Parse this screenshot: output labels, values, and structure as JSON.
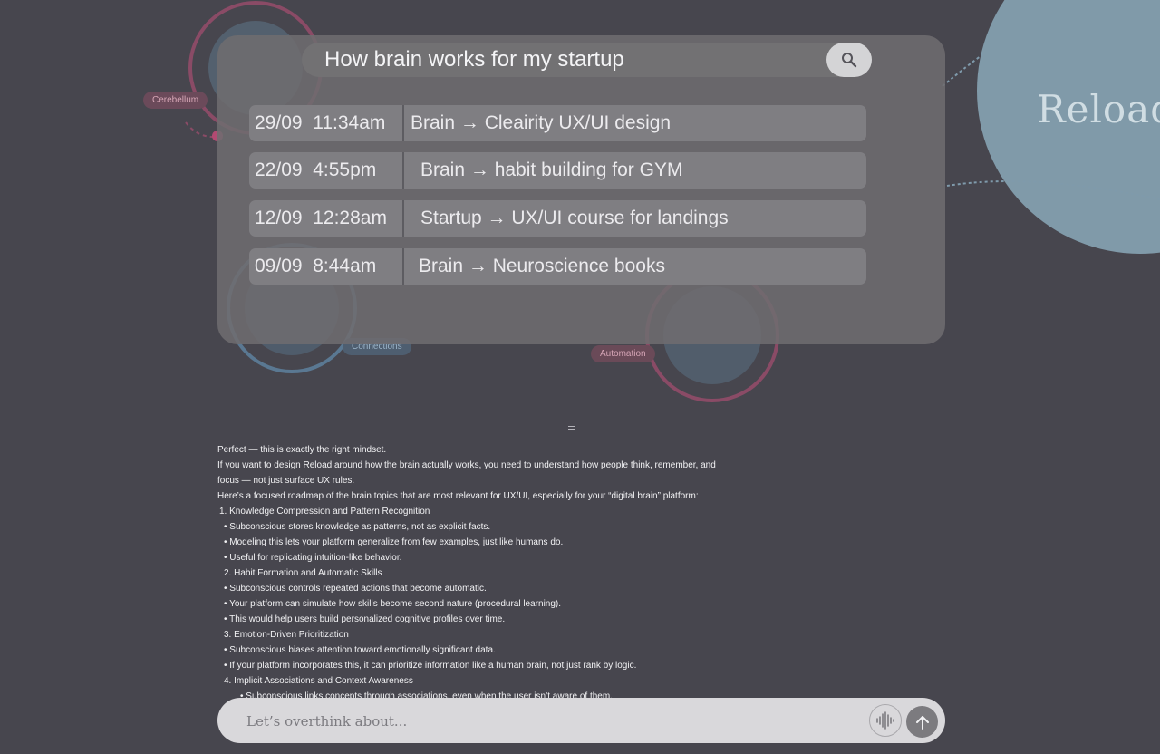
{
  "background": {
    "tags": {
      "cerebellum": "Cerebellum",
      "connections": "Connections",
      "automation": "Automation"
    },
    "brand_word": "Reload"
  },
  "search": {
    "query": "How brain works for my startup",
    "button_icon": "search-icon"
  },
  "history": [
    {
      "date": "29/09",
      "time": "11:34am",
      "title": "Brain → Cleairity UX/UI design"
    },
    {
      "date": "22/09",
      "time": "4:55pm",
      "title": "Brain → habit building for GYM"
    },
    {
      "date": "12/09",
      "time": "12:28am",
      "title": "Startup → UX/UI course for landings"
    },
    {
      "date": "09/09",
      "time": "8:44am",
      "title": "Brain → Neuroscience books"
    }
  ],
  "response": {
    "lines": [
      "Perfect — this is exactly the right mindset.",
      "If you want to design Reload around how the brain actually works, you need to understand how people think, remember, and",
      "focus — not just surface UX rules.",
      "Here’s a focused roadmap of the brain topics that are most relevant for UX/UI, especially for your “digital brain” platform:",
      "1.  Knowledge Compression and Pattern Recognition",
      "•  Subconscious stores knowledge as patterns, not as explicit facts.",
      "•  Modeling this lets your platform generalize from few examples, just like humans do.",
      "•  Useful for replicating intuition-like behavior.",
      "2.  Habit Formation and Automatic Skills",
      "•  Subconscious controls repeated actions that become automatic.",
      "•  Your platform can simulate how skills become second nature (procedural learning).",
      "•  This would help users build personalized cognitive profiles over time.",
      "3.  Emotion-Driven Prioritization",
      "•  Subconscious biases attention toward emotionally significant data.",
      "•  If your platform incorporates this, it can prioritize information like a human brain, not just rank by logic.",
      "4.  Implicit Associations and Context Awareness",
      "•  Subconscious links concepts through associations, even when the user isn’t aware of them."
    ]
  },
  "composer": {
    "placeholder": "Let’s overthink about...",
    "voice_icon": "waveform-icon",
    "send_icon": "arrow-up-icon"
  },
  "colors": {
    "background": "#47464e",
    "panel": "#6e6c70",
    "row": "#7f7e82",
    "composer": "#d9d8db",
    "accent_pink": "#b34a72",
    "accent_blue": "#8ba9ba"
  }
}
